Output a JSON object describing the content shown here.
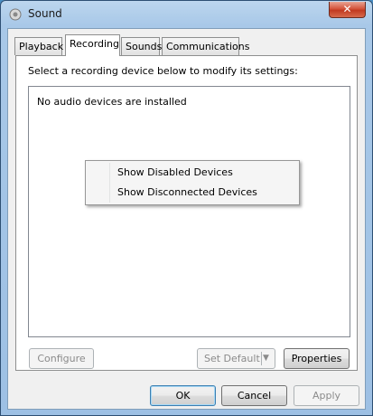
{
  "window": {
    "title": "Sound",
    "app_icon": "speaker-icon",
    "close_label": "✕"
  },
  "tabs": [
    {
      "label": "Playback",
      "active": false
    },
    {
      "label": "Recording",
      "active": true
    },
    {
      "label": "Sounds",
      "active": false
    },
    {
      "label": "Communications",
      "active": false
    }
  ],
  "recording": {
    "instructions": "Select a recording device below to modify its settings:",
    "empty_message": "No audio devices are installed"
  },
  "context_menu": {
    "items": [
      {
        "label": "Show Disabled Devices"
      },
      {
        "label": "Show Disconnected Devices"
      }
    ]
  },
  "panel_buttons": {
    "configure": "Configure",
    "set_default": "Set Default",
    "set_default_arrow": "▼",
    "properties": "Properties"
  },
  "dialog_buttons": {
    "ok": "OK",
    "cancel": "Cancel",
    "apply": "Apply"
  },
  "colors": {
    "window_frame": "#a8c8e8",
    "close_button": "#c13a21",
    "default_button_border": "#3c7fb1"
  }
}
